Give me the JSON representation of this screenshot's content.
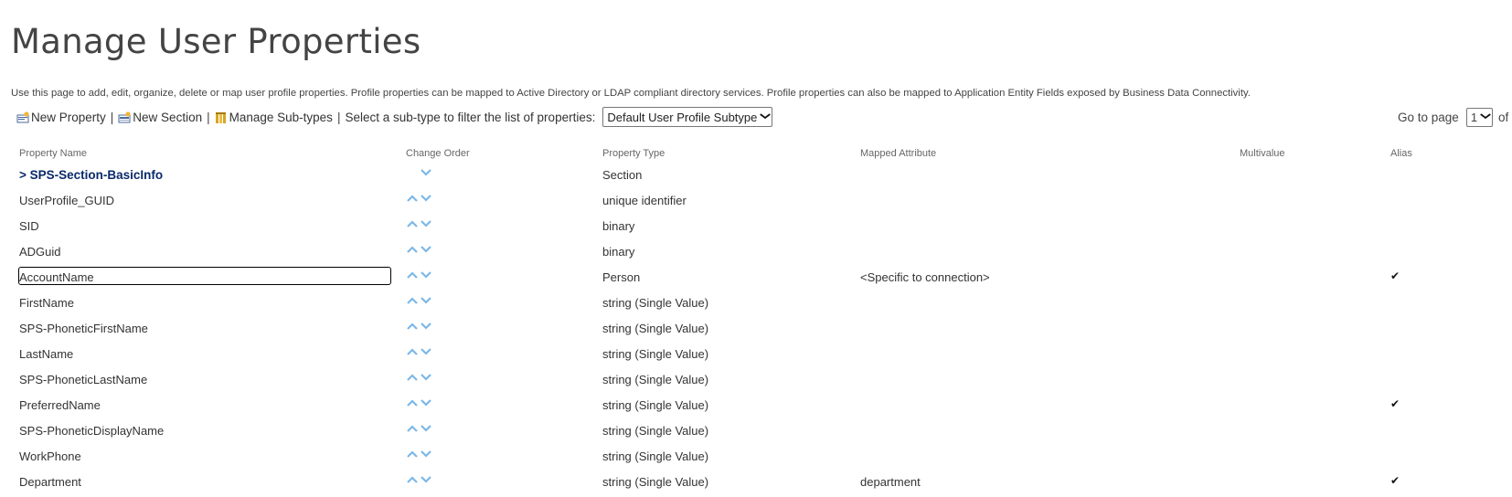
{
  "page": {
    "title": "Manage User Properties",
    "description": "Use this page to add, edit, organize, delete or map user profile properties. Profile properties can be mapped to Active Directory or LDAP compliant directory services. Profile properties can also be mapped to Application Entity Fields exposed by Business Data Connectivity."
  },
  "toolbar": {
    "new_property": "New Property",
    "new_section": "New Section",
    "manage_subtypes": "Manage Sub-types",
    "separator": "|",
    "filter_label": "Select a sub-type to filter the list of properties:",
    "subtype_selected": "Default User Profile Subtype"
  },
  "pager": {
    "label": "Go to page",
    "page_selected": "1",
    "of_label": "of"
  },
  "columns": {
    "name": "Property Name",
    "order": "Change Order",
    "type": "Property Type",
    "mapped": "Mapped Attribute",
    "multivalue": "Multivalue",
    "alias": "Alias"
  },
  "rows": [
    {
      "name": "> SPS-Section-BasicInfo",
      "type": "Section",
      "mapped": "",
      "alias": ""
    },
    {
      "name": "UserProfile_GUID",
      "type": "unique identifier",
      "mapped": "",
      "alias": ""
    },
    {
      "name": "SID",
      "type": "binary",
      "mapped": "",
      "alias": ""
    },
    {
      "name": "ADGuid",
      "type": "binary",
      "mapped": "",
      "alias": ""
    },
    {
      "name": "AccountName",
      "type": "Person",
      "mapped": "<Specific to connection>",
      "alias": "✔"
    },
    {
      "name": "FirstName",
      "type": "string (Single Value)",
      "mapped": "",
      "alias": ""
    },
    {
      "name": "SPS-PhoneticFirstName",
      "type": "string (Single Value)",
      "mapped": "",
      "alias": ""
    },
    {
      "name": "LastName",
      "type": "string (Single Value)",
      "mapped": "",
      "alias": ""
    },
    {
      "name": "SPS-PhoneticLastName",
      "type": "string (Single Value)",
      "mapped": "",
      "alias": ""
    },
    {
      "name": "PreferredName",
      "type": "string (Single Value)",
      "mapped": "",
      "alias": "✔"
    },
    {
      "name": "SPS-PhoneticDisplayName",
      "type": "string (Single Value)",
      "mapped": "",
      "alias": ""
    },
    {
      "name": "WorkPhone",
      "type": "string (Single Value)",
      "mapped": "",
      "alias": ""
    },
    {
      "name": "Department",
      "type": "string (Single Value)",
      "mapped": "department",
      "alias": "✔"
    }
  ],
  "colors": {
    "arrow": "#7cb8e8",
    "section_link": "#0a2a6a"
  }
}
